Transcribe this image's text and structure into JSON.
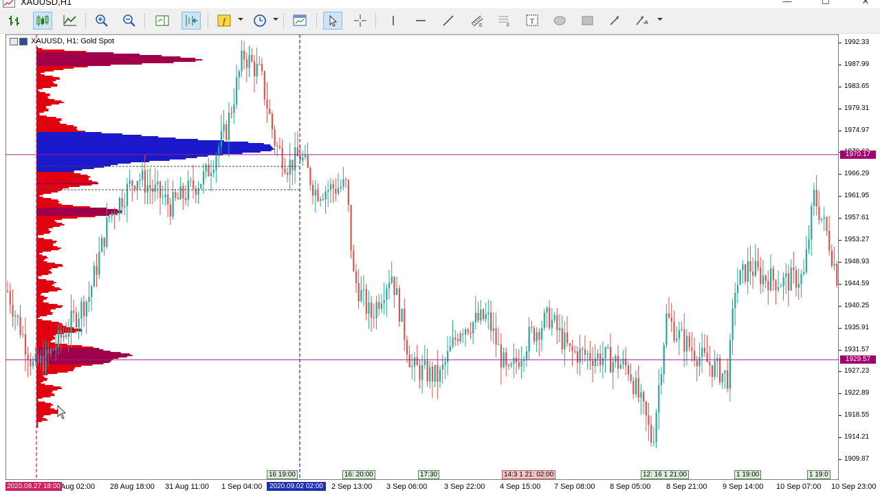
{
  "window": {
    "title": "XAUUSD,H1",
    "controls": [
      "—",
      "☐",
      "✕"
    ]
  },
  "toolbar": {
    "tools": [
      {
        "name": "new-order-icon",
        "pressed": false
      },
      {
        "name": "bar-chart-icon",
        "pressed": true
      },
      {
        "name": "line-chart-icon",
        "pressed": false
      },
      {
        "name": "zoom-in-icon",
        "pressed": false
      },
      {
        "name": "zoom-out-icon",
        "pressed": false
      },
      {
        "name": "chart-shift-icon",
        "pressed": false
      },
      {
        "name": "autoscroll-icon",
        "pressed": true
      },
      {
        "name": "indicators-icon",
        "pressed": false
      },
      {
        "name": "periods-icon",
        "pressed": false
      },
      {
        "name": "templates-icon",
        "pressed": false
      },
      {
        "name": "cursor-icon",
        "pressed": true
      },
      {
        "name": "crosshair-icon",
        "pressed": false
      },
      {
        "name": "vertical-line-icon",
        "pressed": false
      },
      {
        "name": "horizontal-line-icon",
        "pressed": false
      },
      {
        "name": "trendline-icon",
        "pressed": false
      },
      {
        "name": "channel-icon",
        "pressed": false
      },
      {
        "name": "fibonacci-icon",
        "pressed": false
      },
      {
        "name": "text-icon",
        "pressed": false
      },
      {
        "name": "ellipse-icon",
        "pressed": false
      },
      {
        "name": "rectangle-icon",
        "pressed": false
      },
      {
        "name": "arrow-icon",
        "pressed": false
      },
      {
        "name": "shapes-icon",
        "pressed": false
      }
    ]
  },
  "chart": {
    "caption": "XAUUSD, H1:  Gold Spot",
    "colors": {
      "bull": "#26a69a",
      "bear": "#d9534f",
      "profile_red": "#e00010",
      "profile_blue": "#1a1acc",
      "hline": "#9b1e8a",
      "vline": "#1f2fb3"
    },
    "price_scale": [
      "1992.33",
      "1987.99",
      "1983.65",
      "1979.31",
      "1974.97",
      "1970.63",
      "1966.29",
      "1961.95",
      "1957.61",
      "1953.27",
      "1948.93",
      "1944.59",
      "1940.25",
      "1935.91",
      "1931.57",
      "1927.23",
      "1922.89",
      "1918.55",
      "1914.21",
      "1909.87"
    ],
    "hlines": [
      {
        "price": 1970.17,
        "label": "1970.17"
      },
      {
        "price": 1929.57,
        "label": "1929.57"
      }
    ],
    "time_labels": [
      "Aug 02:00",
      "28 Aug 18:00",
      "31 Aug 11:00",
      "1 Sep 04:00",
      "2 Sep 13:00",
      "3 Sep 06:00",
      "3 Sep 22:00",
      "4 Sep 15:00",
      "7 Sep 08:00",
      "8 Sep 05:00",
      "8 Sep 21:00",
      "9 Sep 14:00",
      "10 Sep 07:00",
      "10 Sep 23:00"
    ],
    "time_badge_left": "2020.08.27 18:00",
    "time_badge_right": "2020.09.02 02:00",
    "time_markers": [
      {
        "text": "16 19:00",
        "red": false
      },
      {
        "text": "16: 20:00",
        "red": false
      },
      {
        "text": "17:30",
        "red": false
      },
      {
        "text": "14:3 1 21: 02:00",
        "red": true
      },
      {
        "text": "12: 16 1 21:00",
        "red": false
      },
      {
        "text": "1 19:00",
        "red": false
      },
      {
        "text": "1 19:0",
        "red": false
      }
    ]
  }
}
